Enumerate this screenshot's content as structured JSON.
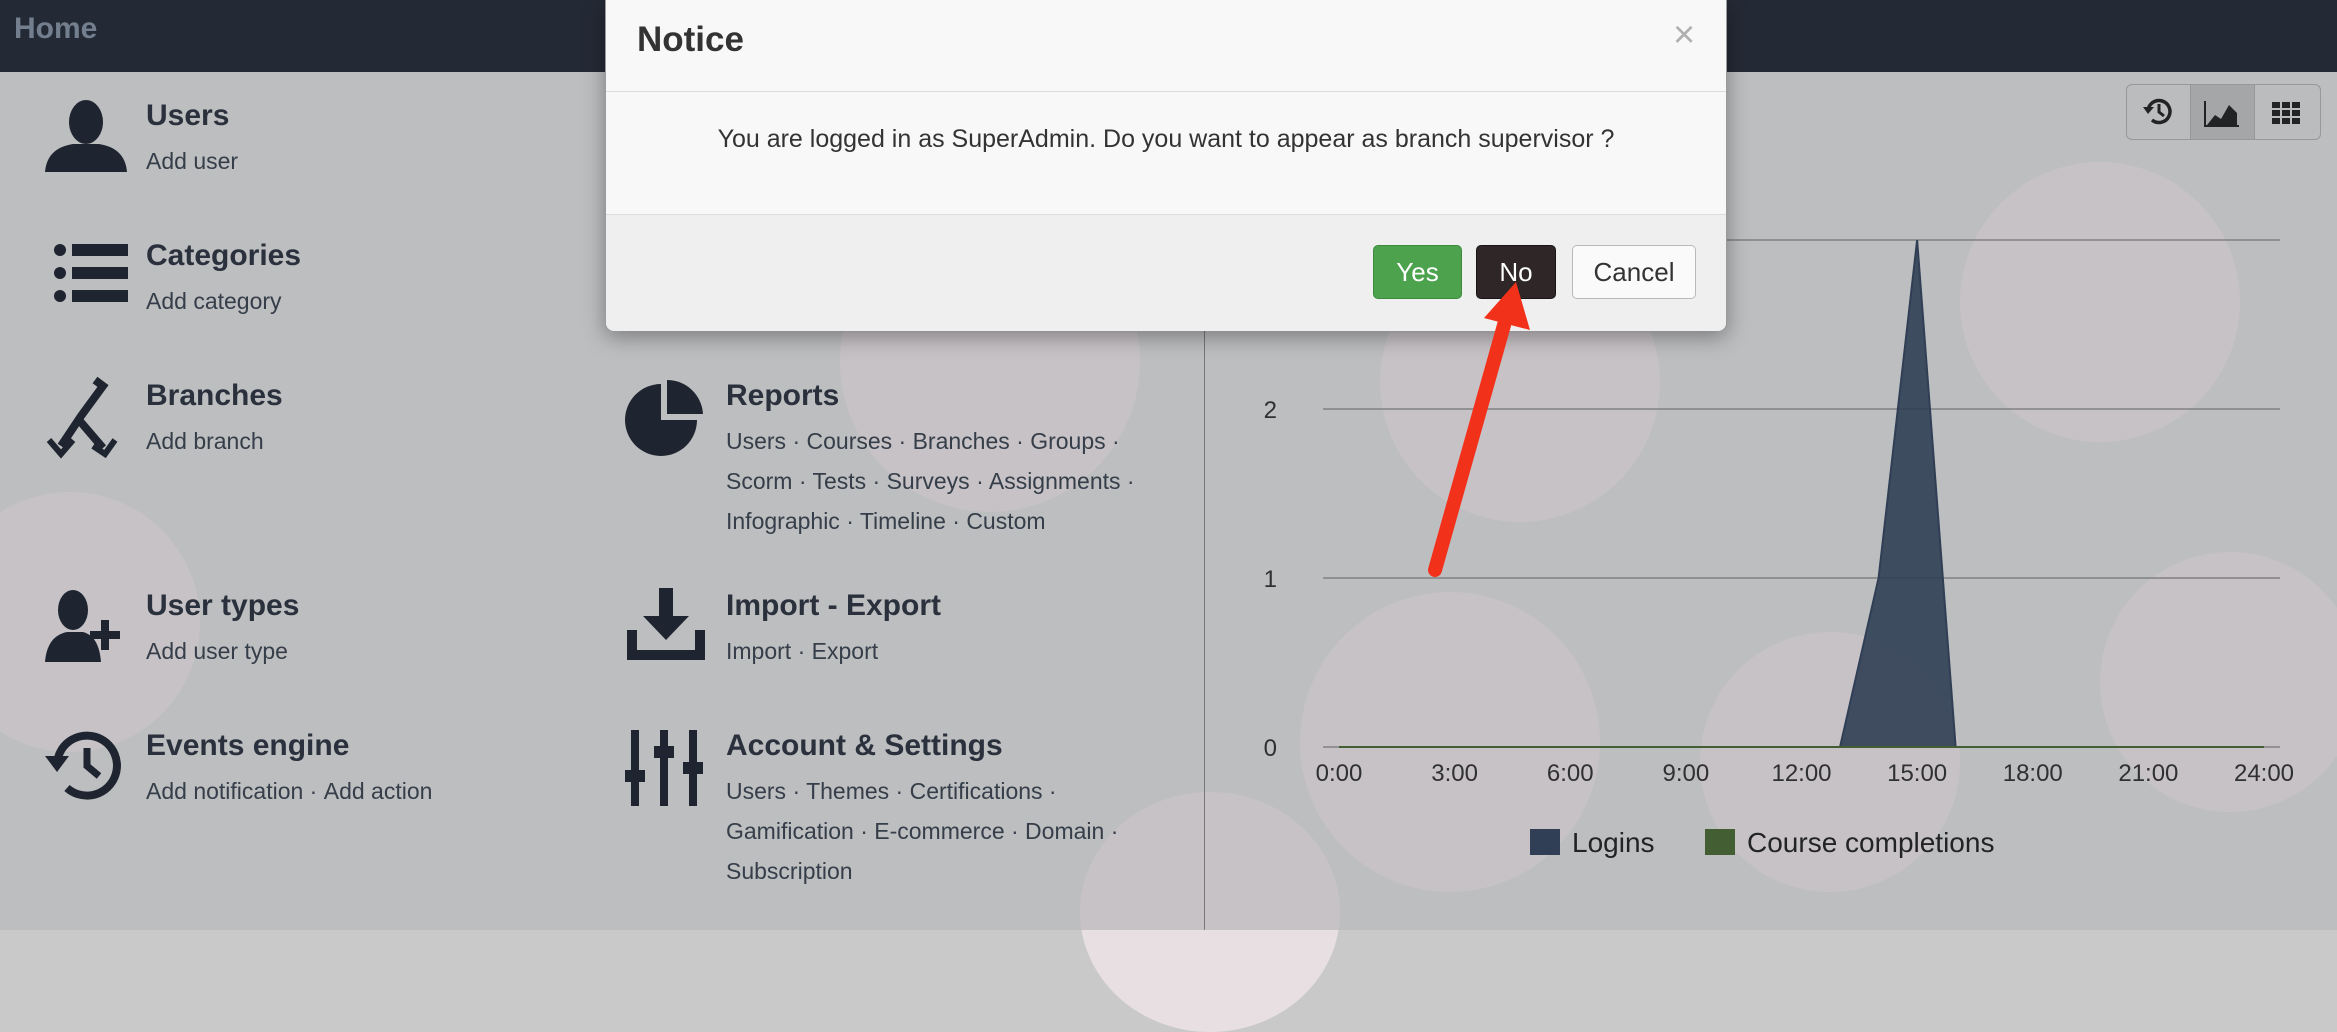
{
  "header": {
    "title": "Home"
  },
  "tiles": {
    "users": {
      "title": "Users",
      "actions": [
        "Add user"
      ]
    },
    "categories": {
      "title": "Categories",
      "actions": [
        "Add category"
      ]
    },
    "branches": {
      "title": "Branches",
      "actions": [
        "Add branch"
      ]
    },
    "user_types": {
      "title": "User types",
      "actions": [
        "Add user type"
      ]
    },
    "events_engine": {
      "title": "Events engine",
      "actions": [
        "Add notification",
        "Add action"
      ]
    },
    "reports": {
      "title": "Reports",
      "lines": [
        "Users · Courses · Branches · Groups ·",
        "Scorm · Tests · Surveys · Assignments ·",
        "Infographic · Timeline · Custom"
      ]
    },
    "import_export": {
      "title": "Import - Export",
      "actions": [
        "Import",
        "Export"
      ]
    },
    "account_settings": {
      "title": "Account & Settings",
      "lines": [
        "Users · Themes · Certifications ·",
        "Gamification · E-commerce · Domain ·",
        "Subscription"
      ]
    }
  },
  "toolbar": {
    "icons": [
      "history-icon",
      "area-chart-icon",
      "grid-icon"
    ],
    "active": "area-chart-icon"
  },
  "chart_data": {
    "type": "area",
    "x": [
      "0:00",
      "1:00",
      "2:00",
      "3:00",
      "4:00",
      "5:00",
      "6:00",
      "7:00",
      "8:00",
      "9:00",
      "10:00",
      "11:00",
      "12:00",
      "13:00",
      "14:00",
      "15:00",
      "16:00",
      "17:00",
      "18:00",
      "19:00",
      "20:00",
      "21:00",
      "22:00",
      "23:00",
      "24:00"
    ],
    "x_ticks": [
      "0:00",
      "3:00",
      "6:00",
      "9:00",
      "12:00",
      "15:00",
      "18:00",
      "21:00",
      "24:00"
    ],
    "series": [
      {
        "name": "Logins",
        "color": "#34465f",
        "values": [
          0,
          0,
          0,
          0,
          0,
          0,
          0,
          0,
          0,
          0,
          0,
          0,
          0,
          0,
          1,
          3,
          0,
          0,
          0,
          0,
          0,
          0,
          0,
          0,
          0
        ]
      },
      {
        "name": "Course completions",
        "color": "#4d6e35",
        "values": [
          0,
          0,
          0,
          0,
          0,
          0,
          0,
          0,
          0,
          0,
          0,
          0,
          0,
          0,
          0,
          0,
          0,
          0,
          0,
          0,
          0,
          0,
          0,
          0,
          0
        ]
      }
    ],
    "y_ticks": [
      "0",
      "1",
      "2"
    ],
    "ylim": [
      0,
      3
    ],
    "grid": true,
    "legend": "bottom"
  },
  "dialog": {
    "title": "Notice",
    "close_label": "×",
    "message": "You are logged in as SuperAdmin. Do you want to appear as branch supervisor ?",
    "buttons": {
      "yes": "Yes",
      "no": "No",
      "cancel": "Cancel"
    }
  }
}
